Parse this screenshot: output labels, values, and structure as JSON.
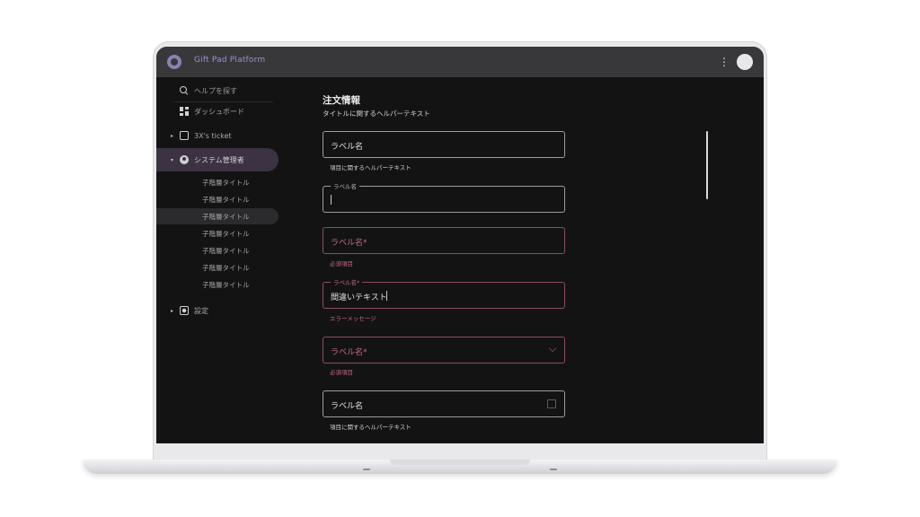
{
  "app": {
    "title": "Gift Pad Platform"
  },
  "sidebar": {
    "search_label": "ヘルプを探す",
    "items": [
      {
        "label": "ダッシュボード",
        "icon": "dashboard-icon"
      },
      {
        "label": "3X's ticket",
        "icon": "ticket-icon"
      },
      {
        "label": "システム管理者",
        "icon": "admin-icon"
      },
      {
        "label": "設定",
        "icon": "settings-icon"
      }
    ],
    "sub_items": [
      "子階層タイトル",
      "子階層タイトル",
      "子階層タイトル",
      "子階層タイトル",
      "子階層タイトル",
      "子階層タイトル",
      "子階層タイトル"
    ]
  },
  "form": {
    "title": "注文情報",
    "subtitle": "タイトルに関するヘルパーテキスト",
    "fields": [
      {
        "value": "ラベル名",
        "helper": "項目に関するヘルパーテキスト"
      },
      {
        "floating_label": "ラベル名",
        "value": ""
      },
      {
        "placeholder": "ラベル名*",
        "helper": "必須項目"
      },
      {
        "floating_label": "ラベル名*",
        "value": "間違いテキスト",
        "helper": "エラーメッセージ"
      },
      {
        "placeholder": "ラベル名*",
        "helper": "必須項目"
      },
      {
        "value": "ラベル名",
        "helper": "項目に関するヘルパーテキスト"
      }
    ]
  },
  "colors": {
    "accent": "#9e90c9",
    "error": "#c46b80",
    "appbar": "#38383b",
    "background": "#131314"
  }
}
